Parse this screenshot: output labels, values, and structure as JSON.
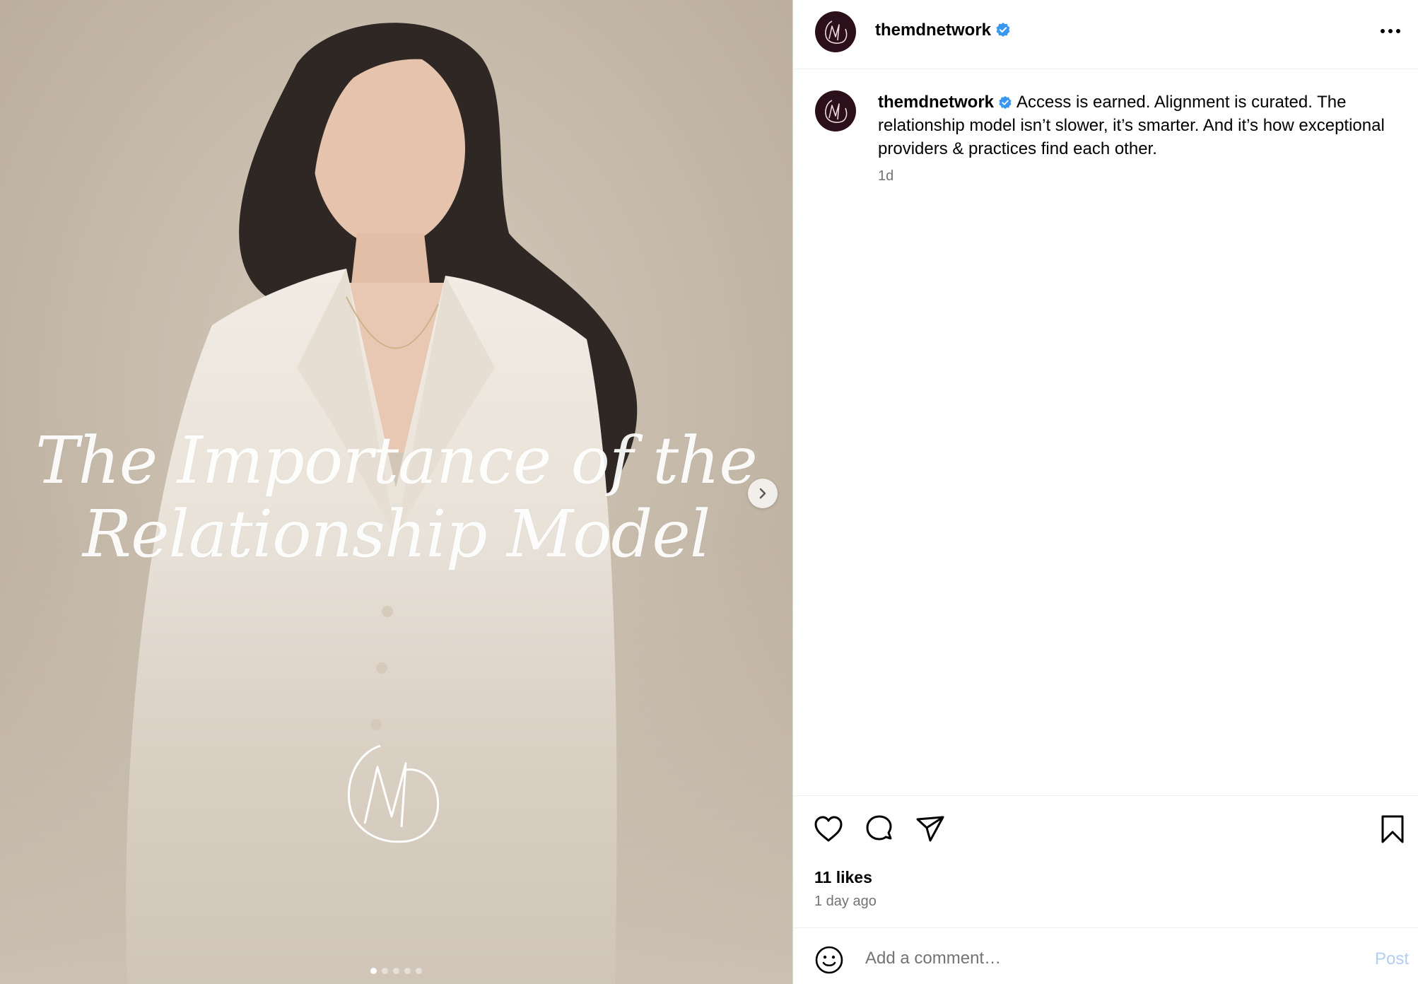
{
  "post": {
    "media": {
      "overlay_line1": "The Importance of the",
      "overlay_line2": "Relationship Model",
      "logo_monogram": "MD",
      "carousel": {
        "total_slides": 5,
        "active_index": 0
      }
    },
    "header": {
      "username": "themdnetwork",
      "verified": true
    },
    "caption": {
      "username": "themdnetwork",
      "text": "Access is earned. Alignment is curated. The relationship model isn’t slower, it’s smarter. And it’s how exceptional providers & practices find each other.",
      "time": "1d"
    },
    "engagement": {
      "likes": "11 likes",
      "time_ago": "1 day ago"
    },
    "comment_box": {
      "placeholder": "Add a comment…",
      "post_label": "Post"
    },
    "icons": {
      "like": "heart-icon",
      "comment": "comment-icon",
      "share": "send-icon",
      "save": "bookmark-icon",
      "more": "more-icon",
      "emoji": "emoji-icon",
      "next": "chevron-right-icon",
      "verified": "verified-badge-icon"
    },
    "colors": {
      "avatar_bg": "#2b0f1a",
      "verified_blue": "#3897f0",
      "post_disabled": "#b3cdf5",
      "secondary_text": "#737373"
    }
  }
}
